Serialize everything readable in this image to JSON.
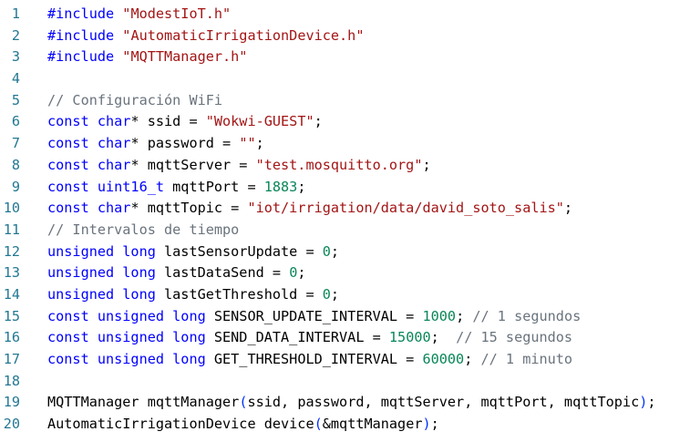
{
  "editor": {
    "lines": [
      {
        "n": "1",
        "tokens": [
          {
            "t": "#include ",
            "c": "pre"
          },
          {
            "t": "\"ModestIoT.h\"",
            "c": "str"
          }
        ]
      },
      {
        "n": "2",
        "tokens": [
          {
            "t": "#include ",
            "c": "pre"
          },
          {
            "t": "\"AutomaticIrrigationDevice.h\"",
            "c": "str"
          }
        ]
      },
      {
        "n": "3",
        "tokens": [
          {
            "t": "#include ",
            "c": "pre"
          },
          {
            "t": "\"MQTTManager.h\"",
            "c": "str"
          }
        ]
      },
      {
        "n": "4",
        "tokens": []
      },
      {
        "n": "5",
        "tokens": [
          {
            "t": "// Configuración WiFi",
            "c": "com"
          }
        ]
      },
      {
        "n": "6",
        "tokens": [
          {
            "t": "const char",
            "c": "kw"
          },
          {
            "t": "* ssid = ",
            "c": ""
          },
          {
            "t": "\"Wokwi-GUEST\"",
            "c": "str"
          },
          {
            "t": ";",
            "c": ""
          }
        ]
      },
      {
        "n": "7",
        "tokens": [
          {
            "t": "const char",
            "c": "kw"
          },
          {
            "t": "* password = ",
            "c": ""
          },
          {
            "t": "\"\"",
            "c": "str"
          },
          {
            "t": ";",
            "c": ""
          }
        ]
      },
      {
        "n": "8",
        "tokens": [
          {
            "t": "const char",
            "c": "kw"
          },
          {
            "t": "* mqttServer = ",
            "c": ""
          },
          {
            "t": "\"test.mosquitto.org\"",
            "c": "str"
          },
          {
            "t": ";",
            "c": ""
          }
        ]
      },
      {
        "n": "9",
        "tokens": [
          {
            "t": "const uint16_t",
            "c": "kw"
          },
          {
            "t": " mqttPort = ",
            "c": ""
          },
          {
            "t": "1883",
            "c": "num"
          },
          {
            "t": ";",
            "c": ""
          }
        ]
      },
      {
        "n": "10",
        "tokens": [
          {
            "t": "const char",
            "c": "kw"
          },
          {
            "t": "* mqttTopic = ",
            "c": ""
          },
          {
            "t": "\"iot/irrigation/data/david_soto_salis\"",
            "c": "str"
          },
          {
            "t": ";",
            "c": ""
          }
        ]
      },
      {
        "n": "11",
        "tokens": [
          {
            "t": "// Intervalos de tiempo",
            "c": "com"
          }
        ]
      },
      {
        "n": "12",
        "tokens": [
          {
            "t": "unsigned long",
            "c": "kw"
          },
          {
            "t": " lastSensorUpdate = ",
            "c": ""
          },
          {
            "t": "0",
            "c": "num"
          },
          {
            "t": ";",
            "c": ""
          }
        ]
      },
      {
        "n": "13",
        "tokens": [
          {
            "t": "unsigned long",
            "c": "kw"
          },
          {
            "t": " lastDataSend = ",
            "c": ""
          },
          {
            "t": "0",
            "c": "num"
          },
          {
            "t": ";",
            "c": ""
          }
        ]
      },
      {
        "n": "14",
        "tokens": [
          {
            "t": "unsigned long",
            "c": "kw"
          },
          {
            "t": " lastGetThreshold = ",
            "c": ""
          },
          {
            "t": "0",
            "c": "num"
          },
          {
            "t": ";",
            "c": ""
          }
        ]
      },
      {
        "n": "15",
        "tokens": [
          {
            "t": "const unsigned long",
            "c": "kw"
          },
          {
            "t": " SENSOR_UPDATE_INTERVAL = ",
            "c": ""
          },
          {
            "t": "1000",
            "c": "num"
          },
          {
            "t": "; ",
            "c": ""
          },
          {
            "t": "// 1 segundos",
            "c": "com"
          }
        ]
      },
      {
        "n": "16",
        "tokens": [
          {
            "t": "const unsigned long",
            "c": "kw"
          },
          {
            "t": " SEND_DATA_INTERVAL = ",
            "c": ""
          },
          {
            "t": "15000",
            "c": "num"
          },
          {
            "t": ";  ",
            "c": ""
          },
          {
            "t": "// 15 segundos",
            "c": "com"
          }
        ]
      },
      {
        "n": "17",
        "tokens": [
          {
            "t": "const unsigned long",
            "c": "kw"
          },
          {
            "t": " GET_THRESHOLD_INTERVAL = ",
            "c": ""
          },
          {
            "t": "60000",
            "c": "num"
          },
          {
            "t": "; ",
            "c": ""
          },
          {
            "t": "// 1 minuto",
            "c": "com"
          }
        ]
      },
      {
        "n": "18",
        "tokens": []
      },
      {
        "n": "19",
        "tokens": [
          {
            "t": "MQTTManager mqttManager",
            "c": ""
          },
          {
            "t": "(",
            "c": "br"
          },
          {
            "t": "ssid, password, mqttServer, mqttPort, mqttTopic",
            "c": ""
          },
          {
            "t": ")",
            "c": "br"
          },
          {
            "t": ";",
            "c": ""
          }
        ]
      },
      {
        "n": "20",
        "tokens": [
          {
            "t": "AutomaticIrrigationDevice device",
            "c": ""
          },
          {
            "t": "(",
            "c": "br"
          },
          {
            "t": "&mqttManager",
            "c": ""
          },
          {
            "t": ")",
            "c": "br"
          },
          {
            "t": ";",
            "c": ""
          }
        ]
      }
    ],
    "colors": {
      "background": "#ffffff",
      "line_number": "#237893",
      "keyword": "#0000ff",
      "string": "#a31515",
      "number": "#098658",
      "comment": "#6a737d",
      "bracket": "#0431fa",
      "text": "#000000"
    }
  }
}
